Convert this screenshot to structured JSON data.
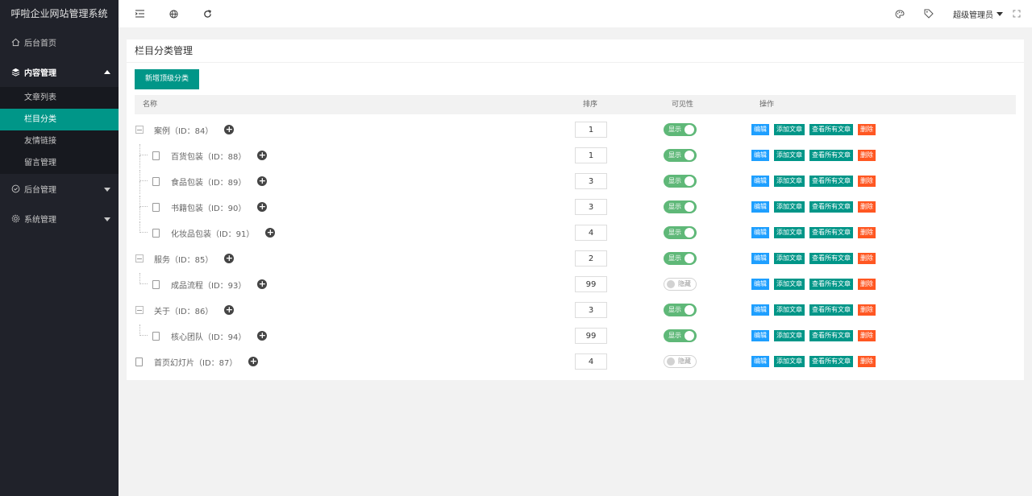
{
  "app": {
    "title": "呼啦企业网站管理系统"
  },
  "sidebar": {
    "items": [
      {
        "label": "后台首页",
        "icon": "home-icon"
      },
      {
        "label": "内容管理",
        "icon": "layers-icon",
        "open": true,
        "children": [
          {
            "label": "文章列表"
          },
          {
            "label": "栏目分类",
            "active": true
          },
          {
            "label": "友情链接"
          },
          {
            "label": "留言管理"
          }
        ]
      },
      {
        "label": "后台管理",
        "icon": "shield-icon"
      },
      {
        "label": "系统管理",
        "icon": "gear-icon"
      }
    ]
  },
  "topbar": {
    "user": "超级管理员"
  },
  "card": {
    "title": "栏目分类管理",
    "add_button": "新增顶级分类",
    "columns": {
      "name": "名称",
      "sort": "排序",
      "visible": "可见性",
      "actions": "操作"
    }
  },
  "actions": {
    "edit": "编辑",
    "add_article": "添加文章",
    "view_all": "查看所有文章",
    "delete": "删除"
  },
  "switch_labels": {
    "on": "显示",
    "off": "隐藏"
  },
  "rows": [
    {
      "name": "案例（ID：84）",
      "level": 0,
      "type": "folder",
      "sort": "1",
      "visible": true
    },
    {
      "name": "百货包装（ID：88）",
      "level": 1,
      "type": "file",
      "sort": "1",
      "visible": true
    },
    {
      "name": "食品包装（ID：89）",
      "level": 1,
      "type": "file",
      "sort": "3",
      "visible": true
    },
    {
      "name": "书籍包装（ID：90）",
      "level": 1,
      "type": "file",
      "sort": "3",
      "visible": true
    },
    {
      "name": "化妆品包装（ID：91）",
      "level": 1,
      "type": "file",
      "sort": "4",
      "visible": true,
      "last": true
    },
    {
      "name": "服务（ID：85）",
      "level": 0,
      "type": "folder",
      "sort": "2",
      "visible": true
    },
    {
      "name": "成品流程（ID：93）",
      "level": 1,
      "type": "file",
      "sort": "99",
      "visible": false,
      "last": true
    },
    {
      "name": "关于（ID：86）",
      "level": 0,
      "type": "folder",
      "sort": "3",
      "visible": true
    },
    {
      "name": "核心团队（ID：94）",
      "level": 1,
      "type": "file",
      "sort": "99",
      "visible": true,
      "last": true
    },
    {
      "name": "首页幻灯片（ID：87）",
      "level": 0,
      "type": "file",
      "sort": "4",
      "visible": false
    }
  ]
}
